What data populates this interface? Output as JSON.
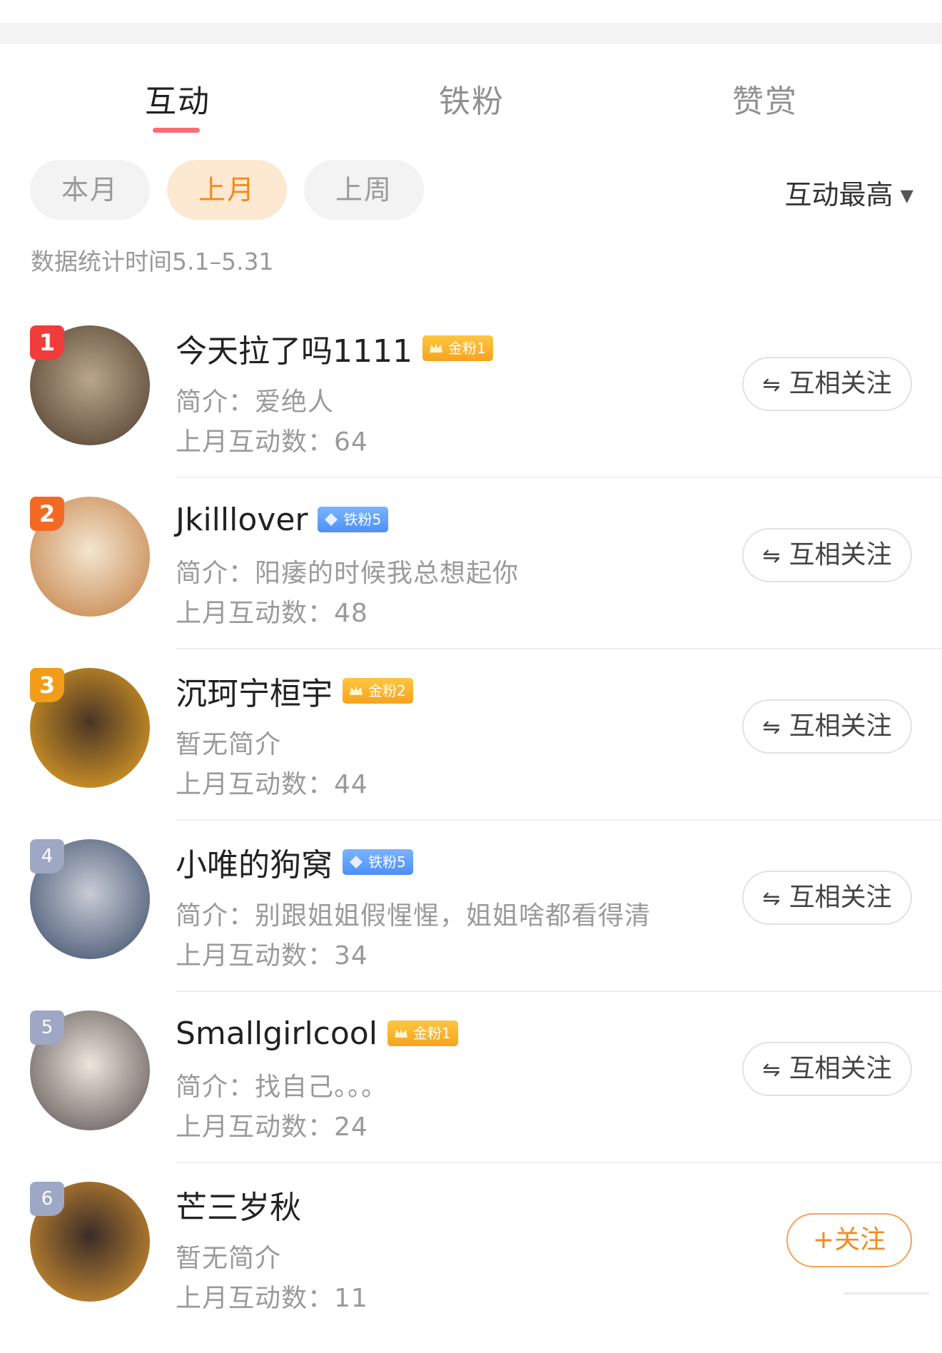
{
  "tabs": [
    {
      "label": "互动",
      "active": true
    },
    {
      "label": "铁粉",
      "active": false
    },
    {
      "label": "赞赏",
      "active": false
    }
  ],
  "filters": [
    {
      "label": "本月",
      "active": false
    },
    {
      "label": "上月",
      "active": true
    },
    {
      "label": "上周",
      "active": false
    }
  ],
  "sort": {
    "label": "互动最高"
  },
  "stat_time": "数据统计时间5.1–5.31",
  "users": [
    {
      "rank": "1",
      "name": "今天拉了吗1111",
      "badge": {
        "type": "gold",
        "label": "金粉1"
      },
      "bio": "简介：爱绝人",
      "count": "上月互动数：64",
      "button": "互相关注",
      "avatar_colors": [
        "#5a4838",
        "#b9a68a"
      ]
    },
    {
      "rank": "2",
      "name": "Jkilllover",
      "badge": {
        "type": "iron",
        "label": "铁粉5"
      },
      "bio": "简介：阳痿的时候我总想起你",
      "count": "上月互动数：48",
      "button": "互相关注",
      "avatar_colors": [
        "#c98a52",
        "#f3e6d0"
      ]
    },
    {
      "rank": "3",
      "name": "沉珂宁桓宇",
      "badge": {
        "type": "gold",
        "label": "金粉2"
      },
      "bio": "暂无简介",
      "count": "上月互动数：44",
      "button": "互相关注",
      "avatar_colors": [
        "#d99a25",
        "#4a3525"
      ]
    },
    {
      "rank": "4",
      "name": "小唯的狗窝",
      "badge": {
        "type": "iron",
        "label": "铁粉5"
      },
      "bio": "简介：别跟姐姐假惺惺，姐姐啥都看得清",
      "count": "上月互动数：34",
      "button": "互相关注",
      "avatar_colors": [
        "#4a5a74",
        "#c8ccd6"
      ]
    },
    {
      "rank": "5",
      "name": "Smallgirlcool",
      "badge": {
        "type": "gold",
        "label": "金粉1"
      },
      "bio": "简介：找自己。。。",
      "count": "上月互动数：24",
      "button": "互相关注",
      "avatar_colors": [
        "#6a6260",
        "#ece6dc"
      ]
    },
    {
      "rank": "6",
      "name": "芒三岁秋",
      "badge": null,
      "bio": "暂无简介",
      "count": "上月互动数：11",
      "button": "+关注",
      "avatar_colors": [
        "#c98a30",
        "#3a2c28"
      ]
    }
  ]
}
